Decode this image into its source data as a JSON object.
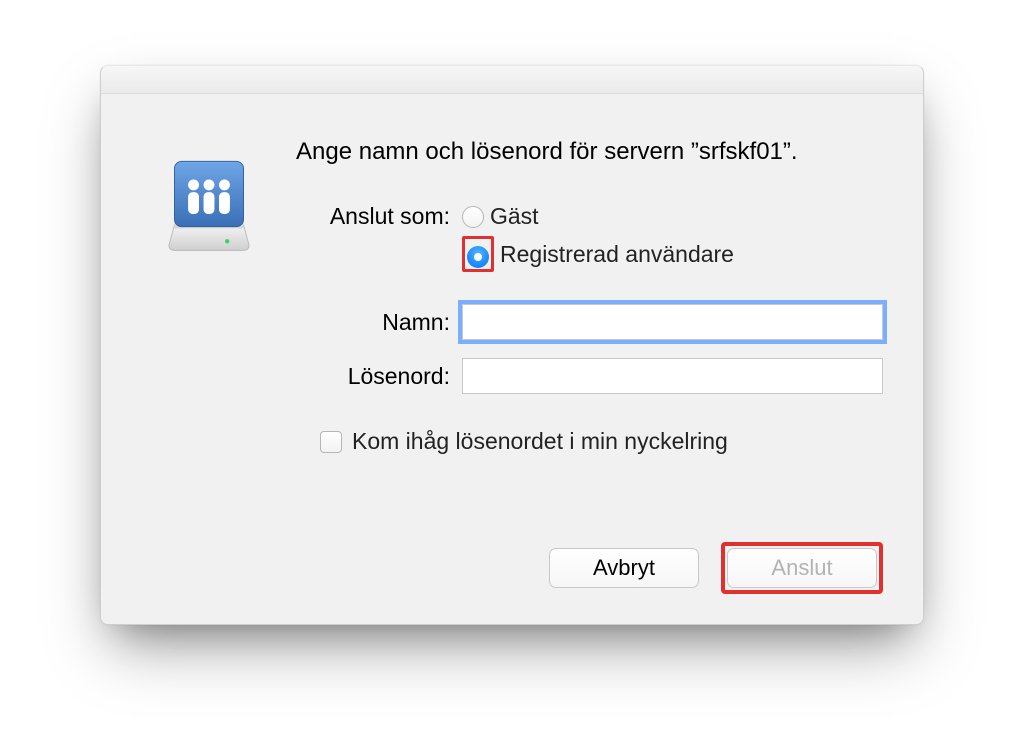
{
  "prompt": "Ange namn och lösenord för servern ”srfskf01”.",
  "connectAsLabel": "Anslut som:",
  "radios": {
    "guest": "Gäst",
    "registered": "Registrerad användare"
  },
  "fields": {
    "nameLabel": "Namn:",
    "nameValue": "",
    "passwordLabel": "Lösenord:",
    "passwordValue": ""
  },
  "remember": {
    "label": "Kom ihåg lösenordet i min nyckelring",
    "checked": false
  },
  "buttons": {
    "cancel": "Avbryt",
    "connect": "Anslut"
  }
}
